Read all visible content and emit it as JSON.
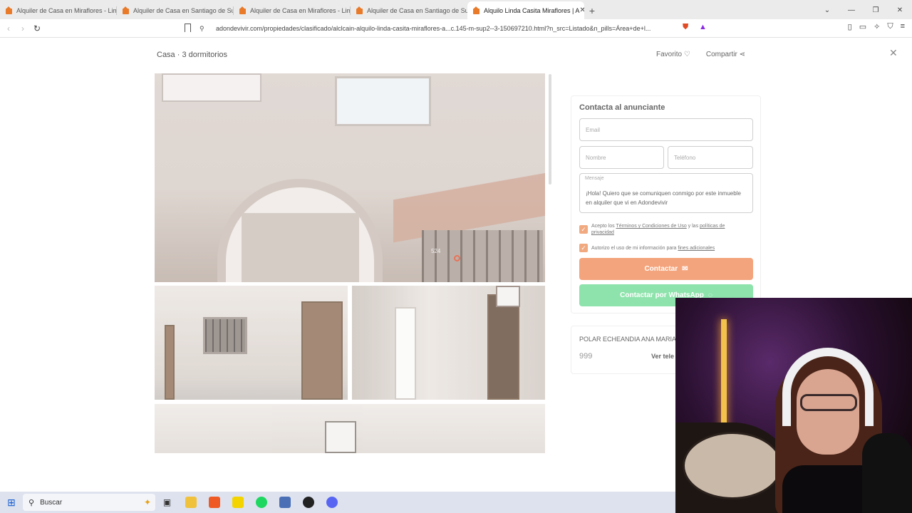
{
  "browser": {
    "tabs": [
      {
        "title": "Alquiler de Casa en Miraflores - Lima",
        "active": false
      },
      {
        "title": "Alquiler de Casa en Santiago de Surco",
        "active": false
      },
      {
        "title": "Alquiler de Casa en Miraflores - Lima",
        "active": false
      },
      {
        "title": "Alquiler de Casa en Santiago de Surco",
        "active": false
      },
      {
        "title": "Alquilo Linda Casita Miraflores | A",
        "active": true
      }
    ],
    "new_tab": "+",
    "url": "adondevivir.com/propiedades/clasificado/alclcain-alquilo-linda-casita-miraflores-a...c.145-m-sup2--3-150697210.html?n_src=Listado&n_pills=Área+de+l..."
  },
  "listing": {
    "title": "Casa · 3 dormitorios",
    "favorite": "Favorito",
    "share": "Compartir",
    "photo_number": "524"
  },
  "contact": {
    "heading": "Contacta al anunciante",
    "email_placeholder": "Email",
    "name_placeholder": "Nombre",
    "phone_placeholder": "Teléfono",
    "message_label": "Mensaje",
    "message_text": "¡Hola! Quiero que se comuniquen conmigo por este inmueble en alquiler que vi en Adondevivir",
    "terms_prefix": "Acepto los ",
    "terms_link": "Términos y Condiciones de Uso",
    "terms_mid": " y las ",
    "privacy_link": "políticas de privacidad",
    "authorize_prefix": "Autorizo el uso de mi información para ",
    "authorize_link": "fines adicionales",
    "contact_button": "Contactar",
    "whatsapp_button": "Contactar por WhatsApp"
  },
  "seller": {
    "name": "POLAR ECHEANDIA ANA MARIA",
    "phone_partial": "999",
    "show_phone": "Ver tele"
  },
  "taskbar": {
    "search_label": "Buscar"
  }
}
